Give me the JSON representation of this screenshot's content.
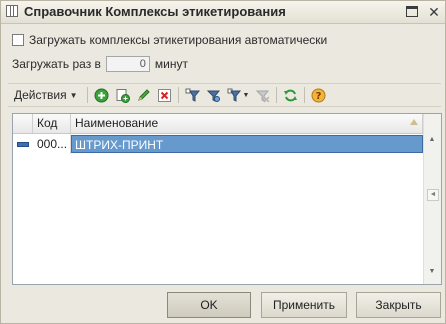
{
  "window": {
    "title": "Справочник Комплексы этикетирования"
  },
  "options": {
    "auto_load_label": "Загружать комплексы этикетирования автоматически",
    "auto_load_checked": false,
    "load_every_label": "Загружать раз в",
    "load_every_value": "0",
    "load_every_unit": "минут"
  },
  "toolbar": {
    "actions_label": "Действия",
    "icons": [
      "add-icon",
      "copy-icon",
      "edit-icon",
      "delete-icon",
      "filter-icon",
      "filter-by-value-icon",
      "filter-history-icon",
      "clear-filter-icon",
      "refresh-icon",
      "help-icon"
    ]
  },
  "table": {
    "columns": [
      "Код",
      "Наименование"
    ],
    "rows": [
      {
        "code": "000...",
        "name": "ШТРИХ-ПРИНТ"
      }
    ]
  },
  "buttons": {
    "ok": "OK",
    "apply": "Применить",
    "close": "Закрыть"
  },
  "colors": {
    "selection": "#6699cc",
    "window_bg": "#ebe8df"
  }
}
